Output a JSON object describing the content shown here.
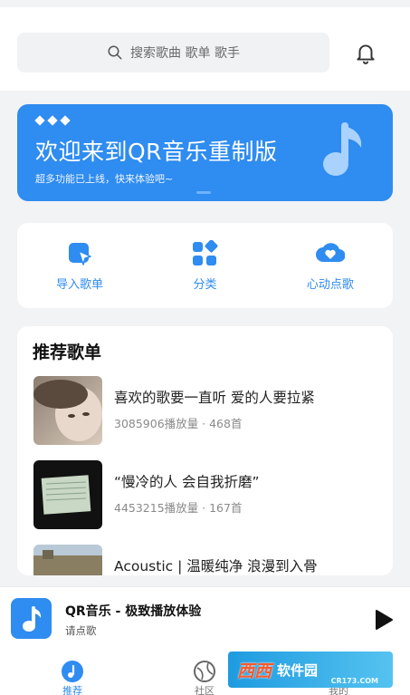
{
  "search": {
    "placeholder": "搜索歌曲 歌单 歌手"
  },
  "banner": {
    "title": "欢迎来到QR音乐重制版",
    "subtitle": "超多功能已上线，快来体验吧~",
    "bg_color": "#2f8cf0"
  },
  "quick_actions": [
    {
      "label": "导入歌单",
      "icon": "import-playlist-icon"
    },
    {
      "label": "分类",
      "icon": "category-icon"
    },
    {
      "label": "心动点歌",
      "icon": "heart-pick-icon"
    }
  ],
  "recommend": {
    "heading": "推荐歌单",
    "playlists": [
      {
        "name": "喜欢的歌要一直听 爱的人要拉紧",
        "meta": "3085906播放量 · 468首"
      },
      {
        "name": "“慢冷的人 会自我折磨”",
        "meta": "4453215播放量 · 167首"
      },
      {
        "name": "Acoustic | 温暖纯净 浪漫到入骨",
        "meta": ""
      }
    ]
  },
  "player": {
    "title": "QR音乐 - 极致播放体验",
    "subtitle": "请点歌"
  },
  "tabs": [
    {
      "label": "推荐",
      "icon": "music-disc-icon",
      "active": true
    },
    {
      "label": "社区",
      "icon": "planet-icon",
      "active": false
    },
    {
      "label": "我的",
      "icon": "user-icon",
      "active": false
    }
  ],
  "watermark": {
    "main": "西西",
    "suffix": "软件园",
    "site": "CR173.COM"
  },
  "accent_color": "#2f8cf0"
}
